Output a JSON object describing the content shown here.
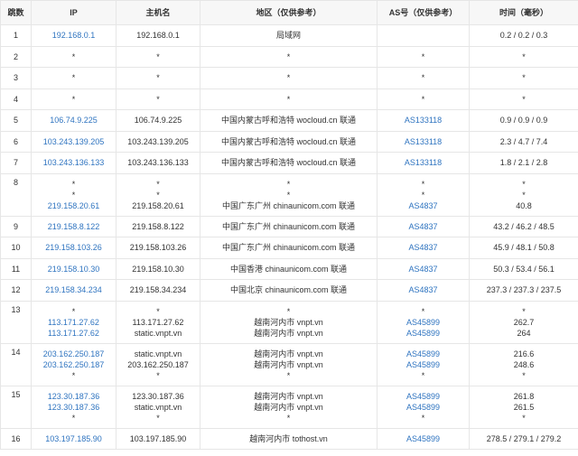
{
  "header": {
    "hop": "跳数",
    "ip": "IP",
    "host": "主机名",
    "region": "地区（仅供参考）",
    "as": "AS号（仅供参考）",
    "time": "时间（毫秒）"
  },
  "rows": [
    {
      "hop": "1",
      "ip": [
        "192.168.0.1"
      ],
      "host": [
        "192.168.0.1"
      ],
      "region": [
        "局域网"
      ],
      "as": [
        ""
      ],
      "time": [
        "0.2 / 0.2 / 0.3"
      ]
    },
    {
      "hop": "2",
      "ip": [
        "*"
      ],
      "host": [
        "*"
      ],
      "region": [
        "*"
      ],
      "as": [
        "*"
      ],
      "time": [
        "*"
      ]
    },
    {
      "hop": "3",
      "ip": [
        "*"
      ],
      "host": [
        "*"
      ],
      "region": [
        "*"
      ],
      "as": [
        "*"
      ],
      "time": [
        "*"
      ]
    },
    {
      "hop": "4",
      "ip": [
        "*"
      ],
      "host": [
        "*"
      ],
      "region": [
        "*"
      ],
      "as": [
        "*"
      ],
      "time": [
        "*"
      ]
    },
    {
      "hop": "5",
      "ip": [
        "106.74.9.225"
      ],
      "host": [
        "106.74.9.225"
      ],
      "region": [
        "中国内蒙古呼和浩特 wocloud.cn 联通"
      ],
      "as": [
        "AS133118"
      ],
      "time": [
        "0.9 / 0.9 / 0.9"
      ]
    },
    {
      "hop": "6",
      "ip": [
        "103.243.139.205"
      ],
      "host": [
        "103.243.139.205"
      ],
      "region": [
        "中国内蒙古呼和浩特 wocloud.cn 联通"
      ],
      "as": [
        "AS133118"
      ],
      "time": [
        "2.3 / 4.7 / 7.4"
      ]
    },
    {
      "hop": "7",
      "ip": [
        "103.243.136.133"
      ],
      "host": [
        "103.243.136.133"
      ],
      "region": [
        "中国内蒙古呼和浩特 wocloud.cn 联通"
      ],
      "as": [
        "AS133118"
      ],
      "time": [
        "1.8 / 2.1 / 2.8"
      ]
    },
    {
      "hop": "8",
      "ip": [
        "*",
        "*",
        "219.158.20.61"
      ],
      "host": [
        "*",
        "*",
        "219.158.20.61"
      ],
      "region": [
        "*",
        "*",
        "中国广东广州 chinaunicom.com 联通"
      ],
      "as": [
        "*",
        "*",
        "AS4837"
      ],
      "time": [
        "*",
        "*",
        "40.8"
      ]
    },
    {
      "hop": "9",
      "ip": [
        "219.158.8.122"
      ],
      "host": [
        "219.158.8.122"
      ],
      "region": [
        "中国广东广州 chinaunicom.com 联通"
      ],
      "as": [
        "AS4837"
      ],
      "time": [
        "43.2 / 46.2 / 48.5"
      ]
    },
    {
      "hop": "10",
      "ip": [
        "219.158.103.26"
      ],
      "host": [
        "219.158.103.26"
      ],
      "region": [
        "中国广东广州 chinaunicom.com 联通"
      ],
      "as": [
        "AS4837"
      ],
      "time": [
        "45.9 / 48.1 / 50.8"
      ]
    },
    {
      "hop": "11",
      "ip": [
        "219.158.10.30"
      ],
      "host": [
        "219.158.10.30"
      ],
      "region": [
        "中国香港 chinaunicom.com 联通"
      ],
      "as": [
        "AS4837"
      ],
      "time": [
        "50.3 / 53.4 / 56.1"
      ]
    },
    {
      "hop": "12",
      "ip": [
        "219.158.34.234"
      ],
      "host": [
        "219.158.34.234"
      ],
      "region": [
        "中国北京 chinaunicom.com 联通"
      ],
      "as": [
        "AS4837"
      ],
      "time": [
        "237.3 / 237.3 / 237.5"
      ]
    },
    {
      "hop": "13",
      "ip": [
        "*",
        "113.171.27.62",
        "113.171.27.62"
      ],
      "host": [
        "*",
        "113.171.27.62",
        "static.vnpt.vn"
      ],
      "region": [
        "*",
        "越南河内市 vnpt.vn",
        "越南河内市 vnpt.vn"
      ],
      "as": [
        "*",
        "AS45899",
        "AS45899"
      ],
      "time": [
        "*",
        "262.7",
        "264"
      ]
    },
    {
      "hop": "14",
      "ip": [
        "203.162.250.187",
        "203.162.250.187",
        "*"
      ],
      "host": [
        "static.vnpt.vn",
        "203.162.250.187",
        "*"
      ],
      "region": [
        "越南河内市 vnpt.vn",
        "越南河内市 vnpt.vn",
        "*"
      ],
      "as": [
        "AS45899",
        "AS45899",
        "*"
      ],
      "time": [
        "216.6",
        "248.6",
        "*"
      ]
    },
    {
      "hop": "15",
      "ip": [
        "123.30.187.36",
        "123.30.187.36",
        "*"
      ],
      "host": [
        "123.30.187.36",
        "static.vnpt.vn",
        "*"
      ],
      "region": [
        "越南河内市 vnpt.vn",
        "越南河内市 vnpt.vn",
        "*"
      ],
      "as": [
        "AS45899",
        "AS45899",
        "*"
      ],
      "time": [
        "261.8",
        "261.5",
        "*"
      ]
    },
    {
      "hop": "16",
      "ip": [
        "103.197.185.90"
      ],
      "host": [
        "103.197.185.90"
      ],
      "region": [
        "越南河内市 tothost.vn"
      ],
      "as": [
        "AS45899"
      ],
      "time": [
        "278.5 / 279.1 / 279.2"
      ]
    }
  ],
  "colors": {
    "link": "#2f74c0",
    "text": "#333333",
    "border": "#e6e6e6"
  }
}
